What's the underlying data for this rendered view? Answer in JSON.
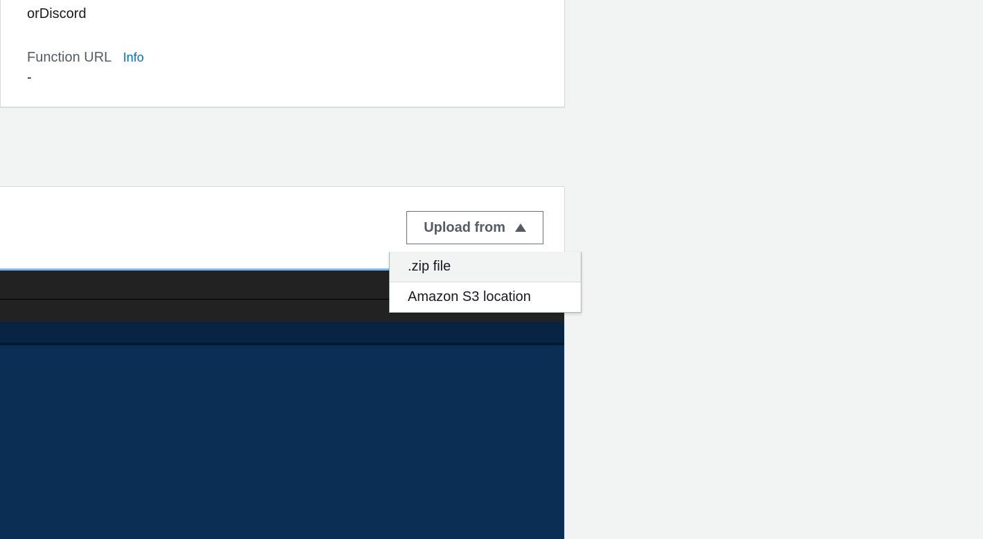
{
  "info_card": {
    "arn_suffix": "orDiscord",
    "function_url_label": "Function URL",
    "info_link": "Info",
    "function_url_value": "-"
  },
  "code_source": {
    "upload_button_label": "Upload from",
    "dropdown": {
      "zip_option": ".zip file",
      "s3_option": "Amazon S3 location"
    }
  }
}
